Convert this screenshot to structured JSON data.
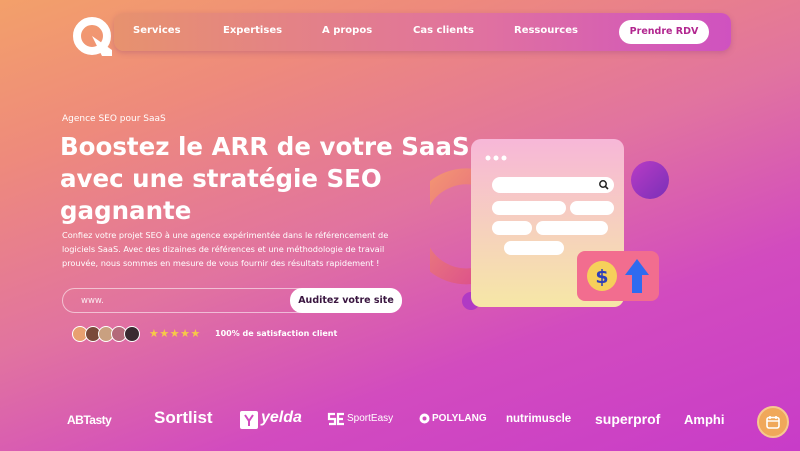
{
  "nav": {
    "items": [
      "Services",
      "Expertises",
      "A propos",
      "Cas clients",
      "Ressources"
    ],
    "cta": "Prendre RDV"
  },
  "hero": {
    "eyebrow": "Agence SEO pour SaaS",
    "headline": [
      "Boostez le ARR de votre SaaS",
      "avec une stratégie SEO",
      "gagnante"
    ],
    "description": [
      "Confiez votre projet SEO à une agence expérimentée dans le référencement de",
      "logiciels SaaS. Avec des dizaines de références et une méthodologie de travail",
      "prouvée, nous sommes en mesure de vous fournir des résultats rapidement !"
    ],
    "url_placeholder": "www.",
    "audit_button": "Auditez votre site",
    "rating_stars": "★★★★★",
    "satisfaction": "100% de satisfaction client"
  },
  "illustration": {
    "currency_symbol": "$"
  },
  "brands": [
    "ABTasty",
    "Sortlist",
    "yelda",
    "SportEasy",
    "POLYLANG",
    "nutrimuscle",
    "superprof",
    "Amphi"
  ],
  "colors": {
    "accent": "#b2268f",
    "star": "#f7c948",
    "arrow": "#2f6bf0"
  }
}
